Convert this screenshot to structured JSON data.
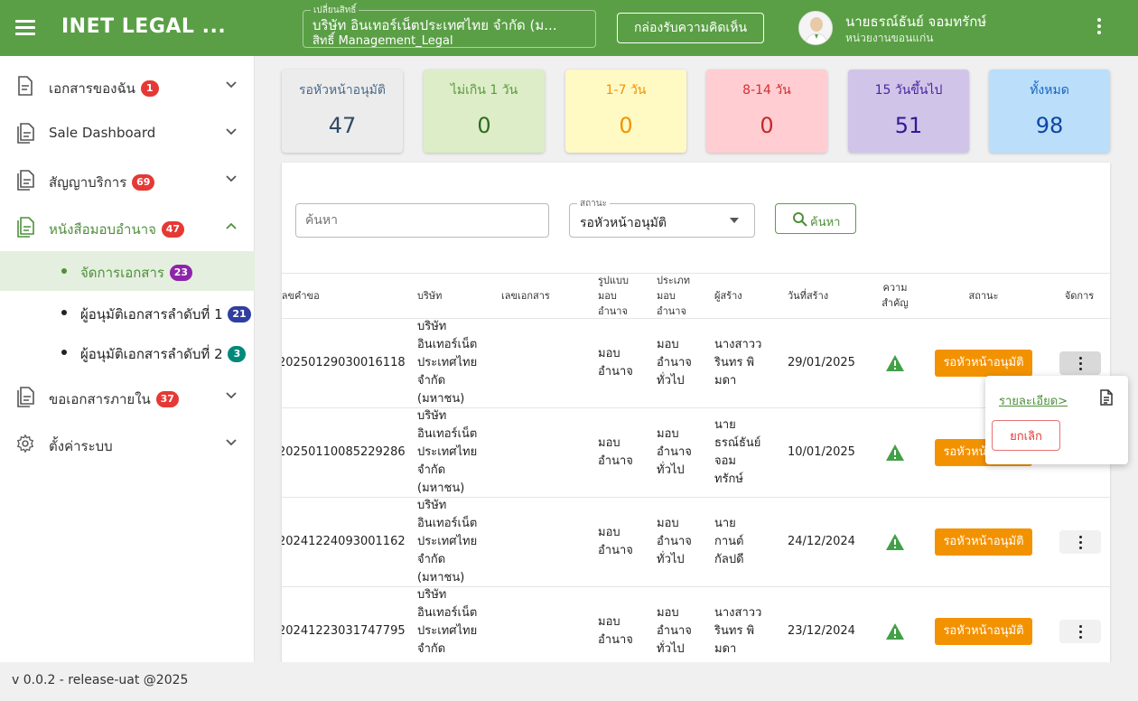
{
  "header": {
    "app_title": "INET LEGAL ...",
    "company_legend": "เปลี่ยนสิทธิ์",
    "company_name": "บริษัท อินเทอร์เน็ตประเทศไทย จำกัด (ม...",
    "company_role": "สิทธิ์ Management_Legal",
    "feedback_label": "กล่องรับความคิดเห็น",
    "user_name": "นายธรณ์ธันย์ จอมทรักษ์",
    "user_unit": "หน่วยงานขอนแก่น"
  },
  "sidebar": {
    "items": [
      {
        "label": "เอกสารของฉัน",
        "badge": "1"
      },
      {
        "label": "Sale Dashboard",
        "badge": ""
      },
      {
        "label": "สัญญาบริการ",
        "badge": "69"
      },
      {
        "label": "หนังสือมอบอำนาจ",
        "badge": "47"
      },
      {
        "label": "ขอเอกสารภายใน",
        "badge": "37"
      },
      {
        "label": "ตั้งค่าระบบ",
        "badge": ""
      }
    ],
    "sub_items": [
      {
        "label": "จัดการเอกสาร",
        "badge": "23"
      },
      {
        "label": "ผู้อนุมัติเอกสารลำดับที่ 1",
        "badge": "21"
      },
      {
        "label": "ผู้อนุมัติเอกสารลำดับที่ 2",
        "badge": "3"
      }
    ]
  },
  "stats": [
    {
      "label": "รอหัวหน้าอนุมัติ",
      "value": "47",
      "bg": "#ececec",
      "label_color": "#4a6b8a",
      "value_color": "#2f4a66"
    },
    {
      "label": "ไม่เกิน 1 วัน",
      "value": "0",
      "bg": "#dcedc8",
      "label_color": "#5a9a3a",
      "value_color": "#2e6b1f"
    },
    {
      "label": "1-7 วัน",
      "value": "0",
      "bg": "#fff9c4",
      "label_color": "#f39200",
      "value_color": "#f39200"
    },
    {
      "label": "8-14 วัน",
      "value": "0",
      "bg": "#ffcdd2",
      "label_color": "#d32f2f",
      "value_color": "#c62828"
    },
    {
      "label": "15 วันขึ้นไป",
      "value": "51",
      "bg": "#d1c4e9",
      "label_color": "#4527a0",
      "value_color": "#311b92"
    },
    {
      "label": "ทั้งหมด",
      "value": "98",
      "bg": "#bbdefb",
      "label_color": "#1565c0",
      "value_color": "#0d47a1"
    }
  ],
  "filters": {
    "search_placeholder": "ค้นหา",
    "status_legend": "สถานะ",
    "status_value": "รอหัวหน้าอนุมัติ",
    "search_button": "ค้นหา"
  },
  "table": {
    "headers": {
      "request_no": "เลขคำขอ",
      "company": "บริษัท",
      "doc_no": "เลขเอกสาร",
      "form_l1": "รูปแบบ",
      "form_l2": "มอบ",
      "form_l3": "อำนาจ",
      "type_l1": "ประเภท",
      "type_l2": "มอบ",
      "type_l3": "อำนาจ",
      "creator": "ผู้สร้าง",
      "created_date": "วันที่สร้าง",
      "importance_l1": "ความ",
      "importance_l2": "สำคัญ",
      "status": "สถานะ",
      "manage": "จัดการ"
    },
    "rows": [
      {
        "request_no": "20250129030016118",
        "company_lines": [
          "บริษัท",
          "อินเทอร์เน็ต",
          "ประเทศไทย",
          "จำกัด",
          "(มหาชน)"
        ],
        "form_lines": [
          "มอบ",
          "อำนาจ"
        ],
        "type_lines": [
          "มอบ",
          "อำนาจ",
          "ทั่วไป"
        ],
        "creator_lines": [
          "นางสาวว",
          "รินทร พิ",
          "มดา"
        ],
        "created_date": "29/01/2025",
        "status": "รอหัวหน้าอนุมัติ"
      },
      {
        "request_no": "20250110085229286",
        "company_lines": [
          "บริษัท",
          "อินเทอร์เน็ต",
          "ประเทศไทย",
          "จำกัด",
          "(มหาชน)"
        ],
        "form_lines": [
          "มอบ",
          "อำนาจ"
        ],
        "type_lines": [
          "มอบ",
          "อำนาจ",
          "ทั่วไป"
        ],
        "creator_lines": [
          "นาย",
          "ธรณ์ธันย์",
          "จอม",
          "ทรักษ์"
        ],
        "created_date": "10/01/2025",
        "status": "รอหัวหน้าอนุมัติ"
      },
      {
        "request_no": "20241224093001162",
        "company_lines": [
          "บริษัท",
          "อินเทอร์เน็ต",
          "ประเทศไทย",
          "จำกัด",
          "(มหาชน)"
        ],
        "form_lines": [
          "มอบ",
          "อำนาจ"
        ],
        "type_lines": [
          "มอบ",
          "อำนาจ",
          "ทั่วไป"
        ],
        "creator_lines": [
          "นาย",
          "กานต์",
          "กัลปดี"
        ],
        "created_date": "24/12/2024",
        "status": "รอหัวหน้าอนุมัติ"
      },
      {
        "request_no": "20241223031747795",
        "company_lines": [
          "บริษัท",
          "อินเทอร์เน็ต",
          "ประเทศไทย",
          "จำกัด"
        ],
        "form_lines": [
          "มอบ",
          "อำนาจ"
        ],
        "type_lines": [
          "มอบ",
          "อำนาจ",
          "ทั่วไป"
        ],
        "creator_lines": [
          "นางสาวว",
          "รินทร พิ",
          "มดา"
        ],
        "created_date": "23/12/2024",
        "status": "รอหัวหน้าอนุมัติ"
      }
    ]
  },
  "popup": {
    "detail_label": "รายละเอียด>",
    "cancel_label": "ยกเลิก"
  },
  "footer": {
    "version": "v 0.0.2 - release-uat @2025"
  }
}
